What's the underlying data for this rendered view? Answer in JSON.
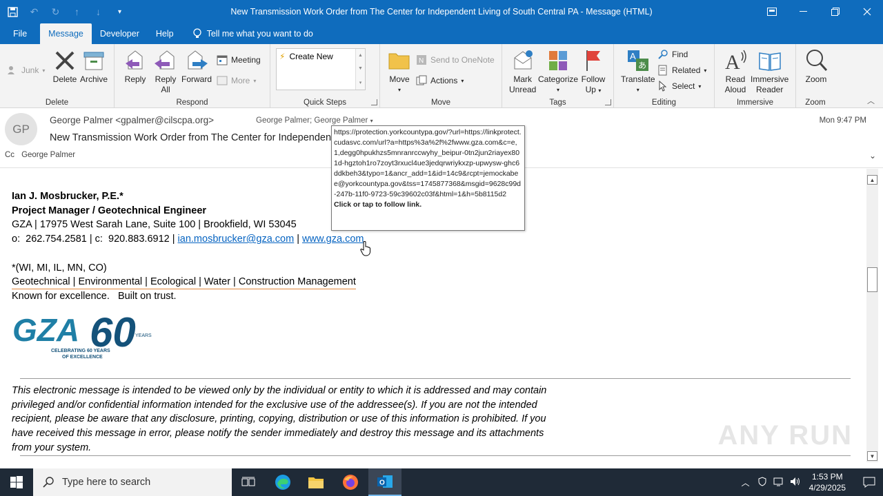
{
  "window": {
    "title": "New Transmission Work Order from The Center for Independent Living of South Central PA  -  Message (HTML)"
  },
  "tabs": {
    "items": [
      "File",
      "Message",
      "Developer",
      "Help"
    ],
    "tellme": "Tell me what you want to do"
  },
  "ribbon": {
    "delete_group": {
      "label": "Delete",
      "junk": "Junk",
      "delete": "Delete",
      "archive": "Archive"
    },
    "respond_group": {
      "label": "Respond",
      "reply": "Reply",
      "reply_all_1": "Reply",
      "reply_all_2": "All",
      "forward": "Forward",
      "meeting": "Meeting",
      "more": "More"
    },
    "quicksteps_group": {
      "label": "Quick Steps",
      "create_new": "Create New"
    },
    "move_group": {
      "label": "Move",
      "move": "Move",
      "onenote": "Send to OneNote",
      "actions": "Actions"
    },
    "tags_group": {
      "label": "Tags",
      "mark_unread_1": "Mark",
      "mark_unread_2": "Unread",
      "categorize": "Categorize",
      "follow_up_1": "Follow",
      "follow_up_2": "Up"
    },
    "editing_group": {
      "label": "Editing",
      "translate": "Translate",
      "find": "Find",
      "related": "Related",
      "select": "Select"
    },
    "immersive_group": {
      "label": "Immersive",
      "read_aloud_1": "Read",
      "read_aloud_2": "Aloud",
      "immersive_reader_1": "Immersive",
      "immersive_reader_2": "Reader"
    },
    "zoom_group": {
      "label": "Zoom",
      "zoom": "Zoom"
    }
  },
  "message": {
    "avatar_initials": "GP",
    "from": "George Palmer <gpalmer@cilscpa.org>",
    "to": "George Palmer; George Palmer",
    "date": "Mon 9:47 PM",
    "subject": "New Transmission Work Order from The Center for Independent Living of South Central PA",
    "cc_label": "Cc",
    "cc": "George Palmer"
  },
  "signature": {
    "name": "Ian J. Mosbrucker, P.E.*",
    "role": "Project Manager / Geotechnical Engineer",
    "address": "GZA | 17975 West Sarah Lane, Suite 100 | Brookfield, WI 53045",
    "phones": "o:  262.754.2581 | c:  920.883.6912 | ",
    "email": "ian.mosbrucker@gza.com",
    "sep": " | ",
    "website": "www.gza.com",
    "states": "*(WI, MI, IL, MN, CO)",
    "services": "Geotechnical | Environmental | Ecological | Water | Construction Management",
    "tagline": "Known for excellence.   Built on trust.",
    "logo_text": "GZA",
    "logo_60": "60",
    "logo_years": "YEARS",
    "logo_celebrating_1": "CELEBRATING 60 YEARS",
    "logo_celebrating_2": "OF EXCELLENCE"
  },
  "disclaimer": "This electronic message is intended to be viewed only by the individual or entity to which it is addressed and may contain privileged and/or confidential information intended for the exclusive use of the addressee(s). If you are not the intended recipient, please be aware that any disclosure, printing, copying, distribution or use of this information is prohibited. If you have received this message in error, please notify the sender immediately and destroy this message and its attachments from your system.",
  "tooltip": {
    "url": "https://protection.yorkcountypa.gov/?url=https://linkprotect.cudasvc.com/url?a=https%3a%2f%2fwww.gza.com&c=e,1,degg0hpukhzs5mnranrccwyhy_beipur-0tn2jun2riayex801d-hgztoh1ro7zoyt3rxucl4ue3jedqrwriykxzp-upwysw-ghc6ddkbeh3&typo=1&ancr_add=1&id=14c9&rcpt=jemockabee@yorkcountypa.gov&tss=1745877368&msgid=9628c99d-247b-11f0-9723-59c39602c03f&html=1&h=5b8115d2",
    "follow": "Click or tap to follow link."
  },
  "watermark": "ANY RUN",
  "taskbar": {
    "search_placeholder": "Type here to search",
    "time": "1:53 PM",
    "date": "4/29/2025"
  },
  "colors": {
    "titlebar": "#0f6cbd",
    "taskbar": "#1f2a37",
    "link": "#0563c1"
  }
}
